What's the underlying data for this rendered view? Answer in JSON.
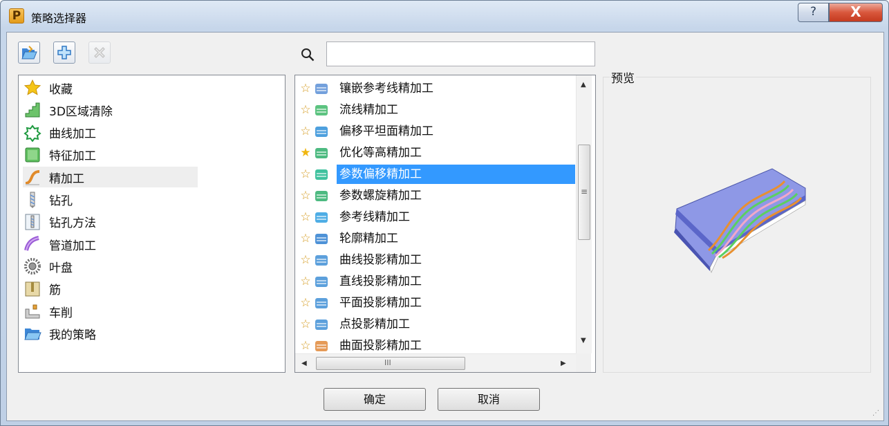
{
  "window": {
    "title": "策略选择器",
    "app_icon_letter": "P",
    "help_label": "?",
    "close_label": "X"
  },
  "toolbar": {
    "open_icon": "folder-open-icon",
    "add_icon": "add-icon",
    "delete_icon": "delete-icon"
  },
  "categories": [
    {
      "label": "收藏",
      "icon": "star-icon"
    },
    {
      "label": "3D区域清除",
      "icon": "area-clearance-icon"
    },
    {
      "label": "曲线加工",
      "icon": "curve-machining-icon"
    },
    {
      "label": "特征加工",
      "icon": "feature-machining-icon"
    },
    {
      "label": "精加工",
      "icon": "finishing-icon",
      "selected": true
    },
    {
      "label": "钻孔",
      "icon": "drill-icon"
    },
    {
      "label": "钻孔方法",
      "icon": "drilling-method-icon"
    },
    {
      "label": "管道加工",
      "icon": "pipe-icon"
    },
    {
      "label": "叶盘",
      "icon": "blisk-icon"
    },
    {
      "label": "筋",
      "icon": "rib-icon"
    },
    {
      "label": "车削",
      "icon": "turning-icon"
    },
    {
      "label": "我的策略",
      "icon": "folder-icon"
    }
  ],
  "search": {
    "value": "",
    "placeholder": ""
  },
  "strategies": [
    {
      "label": "镶嵌参考线精加工",
      "icon": "embedded-pattern-icon",
      "favorite": false
    },
    {
      "label": "流线精加工",
      "icon": "flowline-icon",
      "favorite": false
    },
    {
      "label": "偏移平坦面精加工",
      "icon": "offset-flat-icon",
      "favorite": false
    },
    {
      "label": "优化等高精加工",
      "icon": "optimised-constant-z-icon",
      "favorite": true
    },
    {
      "label": "参数偏移精加工",
      "icon": "parametric-offset-icon",
      "favorite": false,
      "selected": true
    },
    {
      "label": "参数螺旋精加工",
      "icon": "parametric-spiral-icon",
      "favorite": false
    },
    {
      "label": "参考线精加工",
      "icon": "pattern-finishing-icon",
      "favorite": false
    },
    {
      "label": "轮廓精加工",
      "icon": "profile-finishing-icon",
      "favorite": false
    },
    {
      "label": "曲线投影精加工",
      "icon": "curve-projection-icon",
      "favorite": false
    },
    {
      "label": "直线投影精加工",
      "icon": "line-projection-icon",
      "favorite": false
    },
    {
      "label": "平面投影精加工",
      "icon": "plane-projection-icon",
      "favorite": false
    },
    {
      "label": "点投影精加工",
      "icon": "point-projection-icon",
      "favorite": false
    },
    {
      "label": "曲面投影精加工",
      "icon": "surface-projection-icon",
      "favorite": false
    }
  ],
  "preview": {
    "label": "预览",
    "image": "parametric-offset-preview-image"
  },
  "buttons": {
    "ok": "确定",
    "cancel": "取消"
  },
  "scroll": {
    "hthumb_glyph": "III",
    "vthumb_glyph": "≡"
  }
}
